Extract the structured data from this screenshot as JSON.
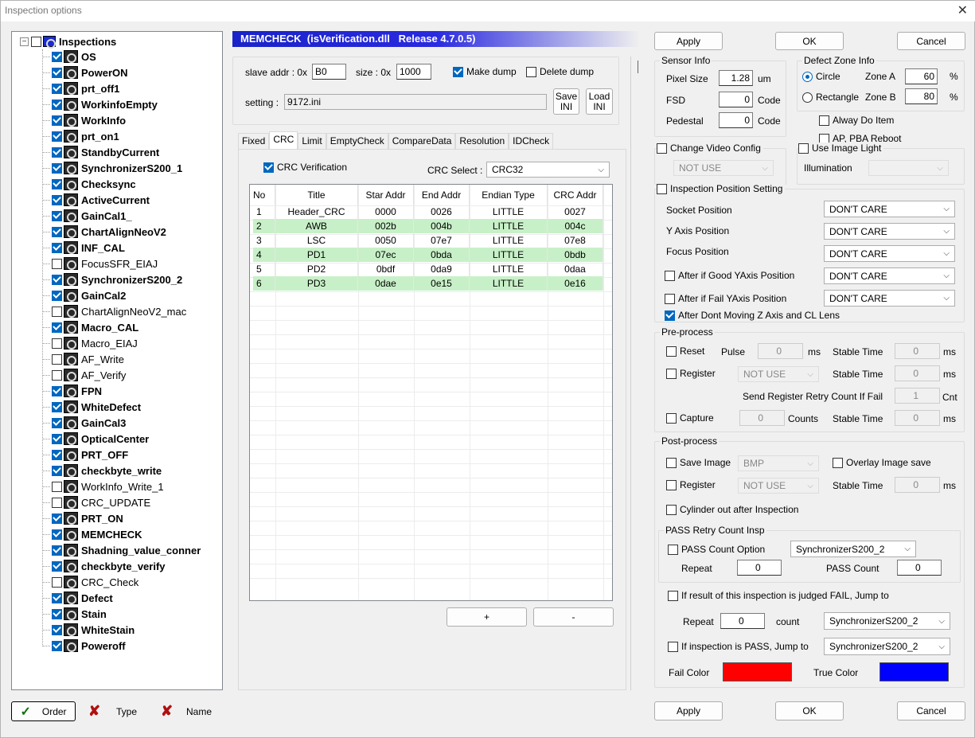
{
  "window": {
    "title": "Inspection options"
  },
  "tree": {
    "root_label": "Inspections",
    "items": [
      {
        "label": "OS",
        "checked": true,
        "bold": true
      },
      {
        "label": "PowerON",
        "checked": true,
        "bold": true
      },
      {
        "label": "prt_off1",
        "checked": true,
        "bold": true
      },
      {
        "label": "WorkinfoEmpty",
        "checked": true,
        "bold": true
      },
      {
        "label": "WorkInfo",
        "checked": true,
        "bold": true
      },
      {
        "label": "prt_on1",
        "checked": true,
        "bold": true
      },
      {
        "label": "StandbyCurrent",
        "checked": true,
        "bold": true
      },
      {
        "label": "SynchronizerS200_1",
        "checked": true,
        "bold": true
      },
      {
        "label": "Checksync",
        "checked": true,
        "bold": true
      },
      {
        "label": "ActiveCurrent",
        "checked": true,
        "bold": true
      },
      {
        "label": "GainCal1_",
        "checked": true,
        "bold": true
      },
      {
        "label": "ChartAlignNeoV2",
        "checked": true,
        "bold": true
      },
      {
        "label": "INF_CAL",
        "checked": true,
        "bold": true
      },
      {
        "label": "FocusSFR_EIAJ",
        "checked": false,
        "bold": false
      },
      {
        "label": "SynchronizerS200_2",
        "checked": true,
        "bold": true
      },
      {
        "label": "GainCal2",
        "checked": true,
        "bold": true
      },
      {
        "label": "ChartAlignNeoV2_mac",
        "checked": false,
        "bold": false
      },
      {
        "label": "Macro_CAL",
        "checked": true,
        "bold": true
      },
      {
        "label": "Macro_EIAJ",
        "checked": false,
        "bold": false
      },
      {
        "label": "AF_Write",
        "checked": false,
        "bold": false
      },
      {
        "label": "AF_Verify",
        "checked": false,
        "bold": false
      },
      {
        "label": "FPN",
        "checked": true,
        "bold": true
      },
      {
        "label": "WhiteDefect",
        "checked": true,
        "bold": true
      },
      {
        "label": "GainCal3",
        "checked": true,
        "bold": true
      },
      {
        "label": "OpticalCenter",
        "checked": true,
        "bold": true
      },
      {
        "label": "PRT_OFF",
        "checked": true,
        "bold": true
      },
      {
        "label": "checkbyte_write",
        "checked": true,
        "bold": true
      },
      {
        "label": "WorkInfo_Write_1",
        "checked": false,
        "bold": false
      },
      {
        "label": "CRC_UPDATE",
        "checked": false,
        "bold": false
      },
      {
        "label": "PRT_ON",
        "checked": true,
        "bold": true
      },
      {
        "label": "MEMCHECK",
        "checked": true,
        "bold": true
      },
      {
        "label": "Shadning_value_conner",
        "checked": true,
        "bold": true
      },
      {
        "label": "checkbyte_verify",
        "checked": true,
        "bold": true
      },
      {
        "label": "CRC_Check",
        "checked": false,
        "bold": false
      },
      {
        "label": "Defect",
        "checked": true,
        "bold": true
      },
      {
        "label": "Stain",
        "checked": true,
        "bold": true
      },
      {
        "label": "WhiteStain",
        "checked": true,
        "bold": true
      },
      {
        "label": "Poweroff",
        "checked": true,
        "bold": true
      }
    ]
  },
  "bottom_left": {
    "order": "Order",
    "type": "Type",
    "name": "Name"
  },
  "header": {
    "title": "MEMCHECK  (isVerification.dll   Release 4.7.0.5)"
  },
  "top": {
    "slave_label": "slave addr : 0x",
    "slave_value": "B0",
    "size_label": "size : 0x",
    "size_value": "1000",
    "make_dump": "Make dump",
    "delete_dump": "Delete dump",
    "setting_label": "setting :",
    "setting_value": "9172.ini",
    "save_ini": "Save INI",
    "load_ini": "Load INI"
  },
  "tabs": [
    "Fixed",
    "CRC",
    "Limit",
    "EmptyCheck",
    "CompareData",
    "Resolution",
    "IDCheck"
  ],
  "crc": {
    "verification": "CRC Verification",
    "select_label": "CRC Select :",
    "select_value": "CRC32",
    "columns": [
      "No",
      "Title",
      "Star Addr",
      "End Addr",
      "Endian Type",
      "CRC Addr"
    ],
    "rows": [
      [
        "1",
        "Header_CRC",
        "0000",
        "0026",
        "LITTLE",
        "0027"
      ],
      [
        "2",
        "AWB",
        "002b",
        "004b",
        "LITTLE",
        "004c"
      ],
      [
        "3",
        "LSC",
        "0050",
        "07e7",
        "LITTLE",
        "07e8"
      ],
      [
        "4",
        "PD1",
        "07ec",
        "0bda",
        "LITTLE",
        "0bdb"
      ],
      [
        "5",
        "PD2",
        "0bdf",
        "0da9",
        "LITTLE",
        "0daa"
      ],
      [
        "6",
        "PD3",
        "0dae",
        "0e15",
        "LITTLE",
        "0e16"
      ]
    ],
    "plus": "+",
    "minus": "-"
  },
  "buttons": {
    "apply": "Apply",
    "ok": "OK",
    "cancel": "Cancel"
  },
  "sensor": {
    "title": "Sensor Info",
    "pixel_label": "Pixel Size",
    "pixel_value": "1.28",
    "pixel_unit": "um",
    "fsd_label": "FSD",
    "fsd_value": "0",
    "fsd_unit": "Code",
    "ped_label": "Pedestal",
    "ped_value": "0",
    "ped_unit": "Code"
  },
  "defect": {
    "title": "Defect Zone Info",
    "circle": "Circle",
    "rect": "Rectangle",
    "zone_a": "Zone A",
    "zone_a_value": "60",
    "zone_b": "Zone B",
    "zone_b_value": "80",
    "pct": "%",
    "alway": "Alway Do Item",
    "ap_reboot": "AP, PBA Reboot"
  },
  "video": {
    "label": "Change Video Config",
    "select": "NOT USE"
  },
  "light": {
    "label": "Use Image Light",
    "illum": "Illumination",
    "select": ""
  },
  "position": {
    "label": "Inspection Position Setting",
    "socket": "Socket Position",
    "yaxis": "Y Axis Position",
    "focus": "Focus Position",
    "after_good": "After if Good YAxis Position",
    "after_fail": "After if Fail YAxis Position",
    "after_dont": "After Dont Moving Z Axis and CL Lens",
    "value": "DON'T CARE"
  },
  "pre": {
    "title": "Pre-process",
    "reset": "Reset",
    "pulse": "Pulse",
    "pulse_value": "0",
    "ms": "ms",
    "stable": "Stable Time",
    "stable_value": "0",
    "register": "Register",
    "reg_select": "NOT USE",
    "retry_label": "Send Register Retry Count If Fail",
    "retry_value": "1",
    "cnt": "Cnt",
    "capture": "Capture",
    "capture_value": "0",
    "counts": "Counts"
  },
  "post": {
    "title": "Post-process",
    "save_image": "Save Image",
    "save_select": "BMP",
    "overlay": "Overlay Image save",
    "register": "Register",
    "reg_select": "NOT USE",
    "stable": "Stable Time",
    "stable_value": "0",
    "ms": "ms",
    "cylinder": "Cylinder out after Inspection",
    "pass_title": "PASS Retry Count Insp",
    "pass_option": "PASS Count Option",
    "pass_select": "SynchronizerS200_2",
    "repeat": "Repeat",
    "repeat_value": "0",
    "pass_count": "PASS Count",
    "pass_count_value": "0",
    "fail_jump": "If result of this inspection is judged FAIL, Jump to",
    "repeat2_value": "0",
    "count": "count",
    "jump_select": "SynchronizerS200_2",
    "pass_jump": "If inspection is PASS, Jump to",
    "pass_jump_select": "SynchronizerS200_2",
    "fail_color": "Fail Color",
    "true_color": "True Color",
    "fail_hex": "#ff0000",
    "true_hex": "#0000ff"
  }
}
